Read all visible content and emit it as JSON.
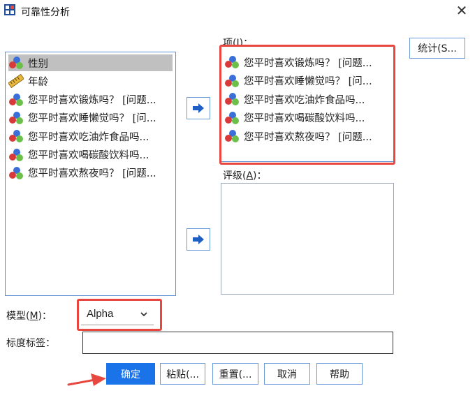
{
  "window": {
    "title": "可靠性分析",
    "close_glyph": "✕"
  },
  "source_list": {
    "items": [
      {
        "label": "性别",
        "icon": "nominal-variable-icon",
        "selected": true
      },
      {
        "label": "年龄",
        "icon": "scale-ruler-icon",
        "selected": false
      },
      {
        "label": "您平时喜欢锻炼吗？ [问题...",
        "icon": "nominal-variable-icon",
        "selected": false
      },
      {
        "label": "您平时喜欢睡懒觉吗？ [问...",
        "icon": "nominal-variable-icon",
        "selected": false
      },
      {
        "label": "您平时喜欢吃油炸食品吗...",
        "icon": "nominal-variable-icon",
        "selected": false
      },
      {
        "label": "您平时喜欢喝碳酸饮料吗...",
        "icon": "nominal-variable-icon",
        "selected": false
      },
      {
        "label": "您平时喜欢熬夜吗？ [问题...",
        "icon": "nominal-variable-icon",
        "selected": false
      }
    ]
  },
  "items_section": {
    "label_text": "项(",
    "label_key": "I",
    "label_end": ")：",
    "items": [
      {
        "label": "您平时喜欢锻炼吗？ [问题..."
      },
      {
        "label": "您平时喜欢睡懒觉吗？ [问..."
      },
      {
        "label": "您平时喜欢吃油炸食品吗..."
      },
      {
        "label": "您平时喜欢喝碳酸饮料吗..."
      },
      {
        "label": "您平时喜欢熬夜吗？ [问题..."
      }
    ]
  },
  "ratings_section": {
    "label_text": "评级(",
    "label_key": "A",
    "label_end": ")："
  },
  "stats_button": "统计(S...",
  "model": {
    "label_text": "模型(",
    "label_key": "M",
    "label_end": ")：",
    "value": "Alpha"
  },
  "scale_label": {
    "label": "标度标签：",
    "value": ""
  },
  "buttons": {
    "ok": "确定",
    "paste": "粘贴(...",
    "reset": "重置(...",
    "cancel": "取消",
    "help": "帮助"
  },
  "colors": {
    "accent": "#1a73e8",
    "highlight": "#e8473f",
    "list_border": "#5b8fd6"
  }
}
